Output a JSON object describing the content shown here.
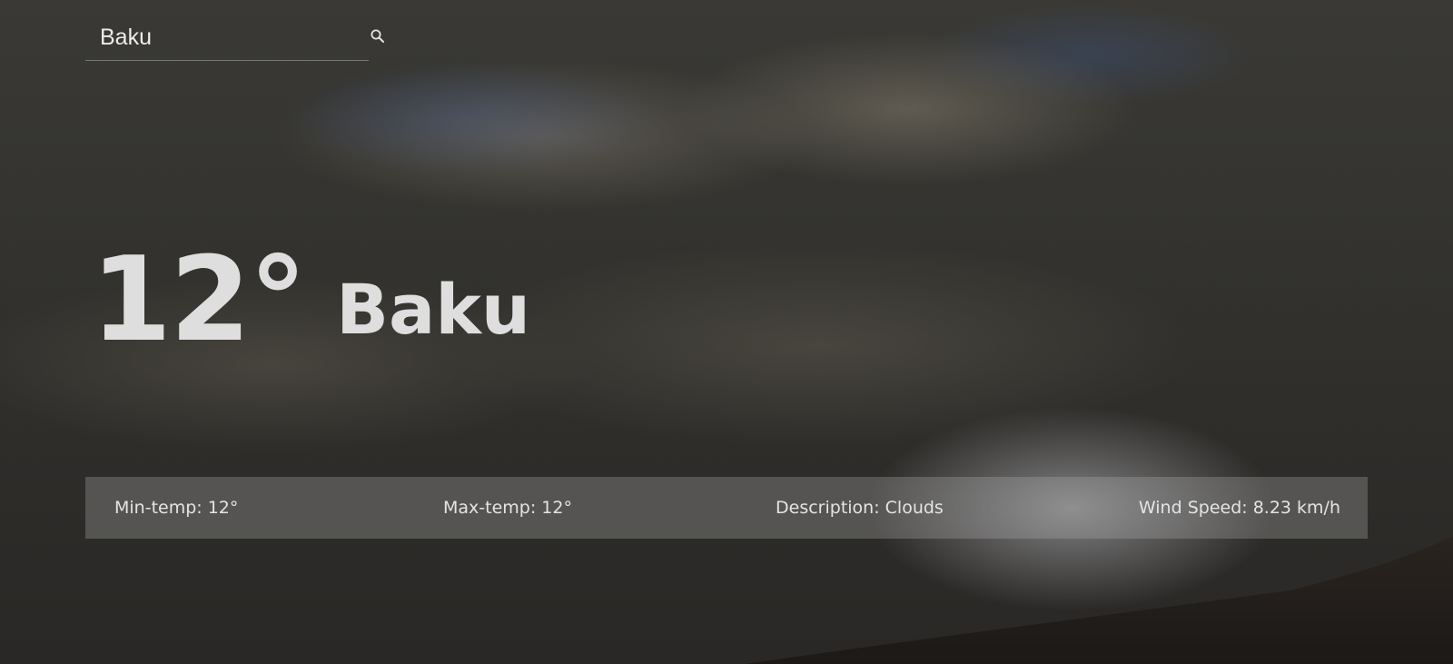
{
  "search": {
    "value": "Baku",
    "icon": "search-icon"
  },
  "current": {
    "temperature": "12°",
    "city": "Baku"
  },
  "details": {
    "min_temp": "Min-temp: 12°",
    "max_temp": "Max-temp: 12°",
    "description": "Description: Clouds",
    "wind_speed": "Wind Speed: 8.23 km/h"
  },
  "colors": {
    "text": "#e6e6e6",
    "info_bar": "#aaaaac"
  }
}
